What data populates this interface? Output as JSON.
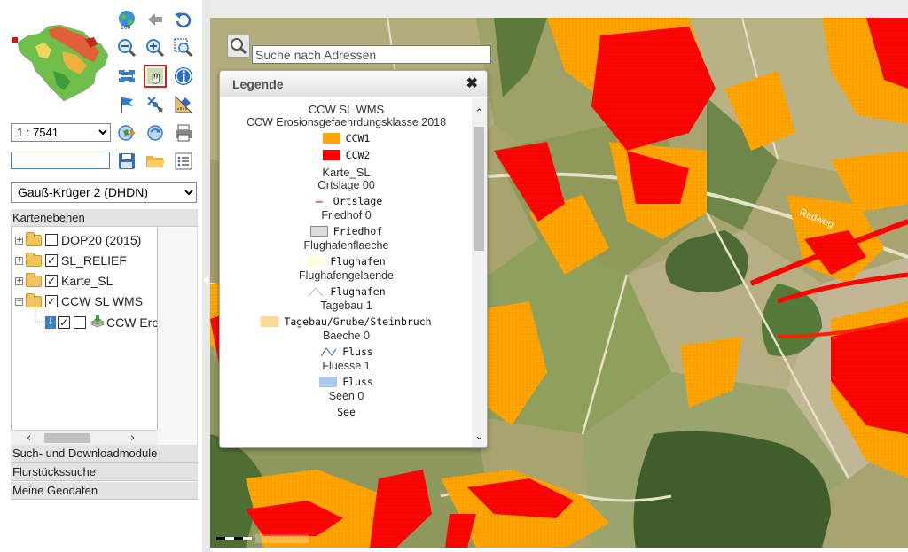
{
  "scale": {
    "value": "1 : 7541"
  },
  "coordinate_input": {
    "value": ""
  },
  "projection": {
    "value": "Gauß-Krüger 2 (DHDN)"
  },
  "panels": {
    "layers_title": "Kartenebenen",
    "search_download": "Such- und Downloadmodule",
    "parcel_search": "Flurstückssuche",
    "my_geodata": "Meine Geodaten"
  },
  "layers": [
    {
      "label": "DOP20 (2015)",
      "checked": false,
      "expand": "+"
    },
    {
      "label": "SL_RELIEF",
      "checked": true,
      "expand": "+"
    },
    {
      "label": "Karte_SL",
      "checked": true,
      "expand": "+"
    },
    {
      "label": "CCW SL WMS",
      "checked": true,
      "expand": "−"
    }
  ],
  "sublayer": {
    "label": "CCW Erosionsgefaehrdungsklasse 2018",
    "checked": true
  },
  "search": {
    "placeholder": "Suche nach Adressen"
  },
  "legend": {
    "title": "Legende",
    "service": "CCW SL WMS",
    "layer": "CCW Erosionsgefaehrdungsklasse 2018",
    "ccw1": "CCW1",
    "ccw2": "CCW2",
    "karte": "Karte_SL",
    "ortslage_group": "Ortslage 00",
    "ortslage": "Ortslage",
    "friedhof_group": "Friedhof 0",
    "friedhof": "Friedhof",
    "flughafenflaeche_group": "Flughafenflaeche",
    "flughafen1": "Flughafen",
    "flughafengelaende_group": "Flughafengelaende",
    "flughafen2": "Flughafen",
    "tagebau_group": "Tagebau 1",
    "tagebau": "Tagebau/Grube/Steinbruch",
    "baeche_group": "Baeche 0",
    "fluss1": "Fluss",
    "fluesse_group": "Fluesse 1",
    "fluss2": "Fluss",
    "seen_group": "Seen 0",
    "see": "See"
  },
  "map_labels": {
    "road": "Radweg"
  },
  "colors": {
    "ccw1": "#ffa500",
    "ccw2": "#ff0000",
    "flughafen": "#ffffe0",
    "tagebau": "#fcd98c",
    "fluss_area": "#a8c8ec",
    "link_blue": "#4a7fb3"
  },
  "icons": [
    "globe-icon",
    "back-arrow-icon",
    "undo-icon",
    "zoom-out-icon",
    "zoom-in-icon",
    "zoom-box-icon",
    "pan-icon",
    "select-hand-icon",
    "info-icon",
    "flag-icon",
    "measure-icon",
    "ruler-icon",
    "print-preview-icon",
    "refresh-icon",
    "printer-icon",
    "save-icon",
    "open-folder-icon",
    "list-icon"
  ]
}
